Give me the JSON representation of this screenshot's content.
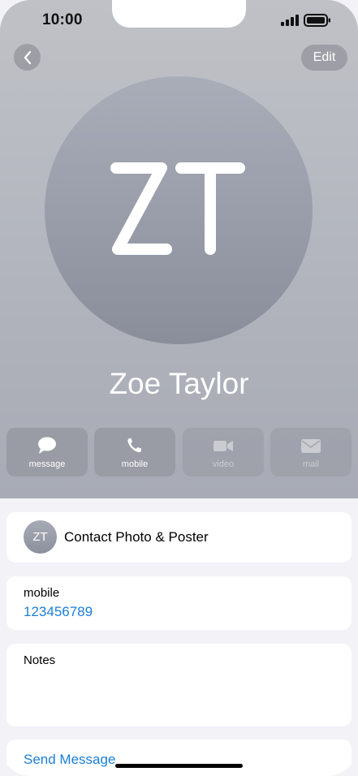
{
  "status_bar": {
    "time": "10:00"
  },
  "nav": {
    "back_icon": "chevron-left-icon",
    "edit_label": "Edit"
  },
  "contact": {
    "initials": "ZT",
    "name": "Zoe Taylor"
  },
  "actions": [
    {
      "label": "message",
      "icon": "speech-bubble-icon",
      "enabled": true
    },
    {
      "label": "mobile",
      "icon": "phone-icon",
      "enabled": true
    },
    {
      "label": "video",
      "icon": "video-camera-icon",
      "enabled": false
    },
    {
      "label": "mail",
      "icon": "envelope-icon",
      "enabled": false
    }
  ],
  "photo_card": {
    "initials": "ZT",
    "label": "Contact Photo & Poster"
  },
  "phone_card": {
    "label": "mobile",
    "number": "123456789"
  },
  "notes_card": {
    "label": "Notes"
  },
  "send_card": {
    "label": "Send Message"
  },
  "colors": {
    "accent": "#1a7fd6",
    "header_gray": "#b4b7bf"
  }
}
